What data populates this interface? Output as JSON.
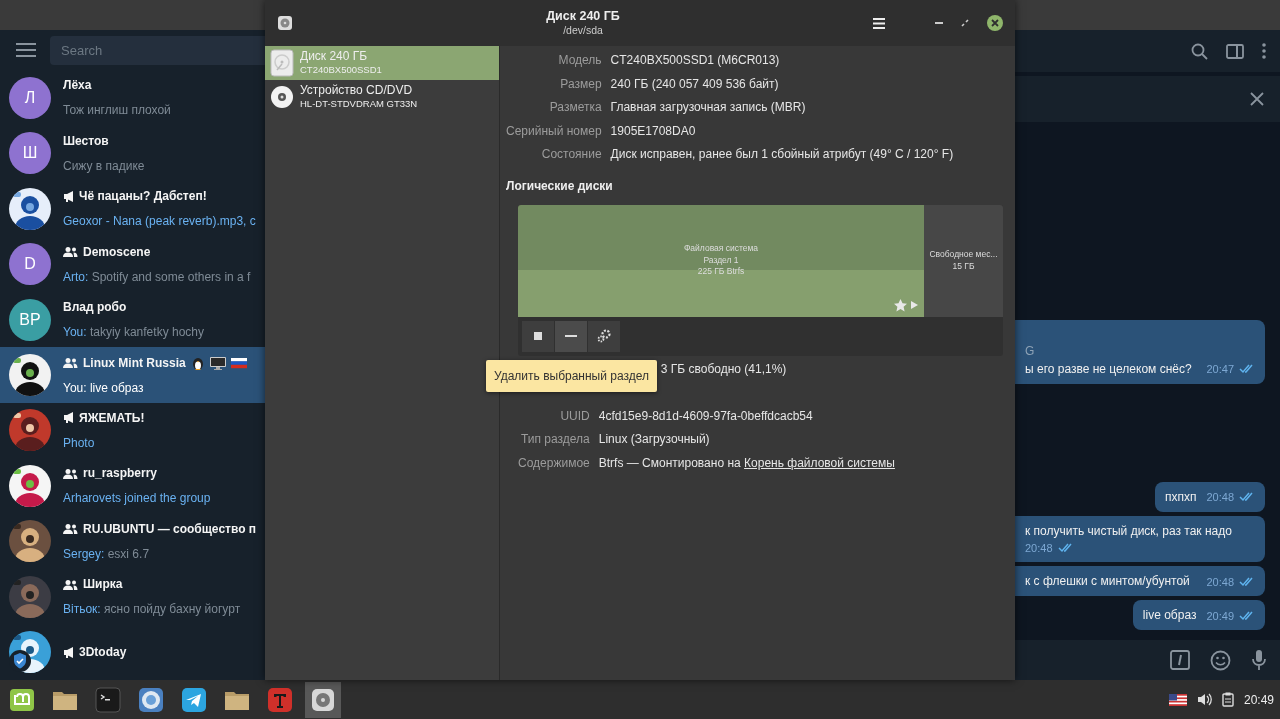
{
  "telegram": {
    "search": {
      "placeholder": "Search"
    },
    "chats": [
      {
        "name": "Лёха",
        "kind": "user",
        "avatar": {
          "kind": "letter",
          "letter": "Л",
          "color": "#8e72d0"
        },
        "preview": {
          "text": "Тож инглиш плохой",
          "highlight": false
        },
        "selected": false,
        "emoji_badges": false
      },
      {
        "name": "Шестов",
        "kind": "user",
        "avatar": {
          "kind": "letter",
          "letter": "Ш",
          "color": "#8e72d0"
        },
        "preview": {
          "text": "Сижу в падике",
          "highlight": false
        },
        "selected": false,
        "emoji_badges": false
      },
      {
        "name": "Чё пацаны? Дабстеп!",
        "kind": "channel",
        "preview": {
          "text": "Geoxor - Nana (peak reverb).mp3, c",
          "highlight": true
        },
        "selected": false,
        "emoji_badges": false
      },
      {
        "name": "Demoscene",
        "kind": "group",
        "avatar": {
          "kind": "letter",
          "letter": "D",
          "color": "#8e72d0"
        },
        "preview": {
          "sender": "Arto:",
          "text": "Spotify and some others in a f",
          "highlight": false
        },
        "selected": false,
        "emoji_badges": false
      },
      {
        "name": "Влад робо",
        "kind": "user",
        "avatar": {
          "kind": "letter",
          "letter": "ВР",
          "color": "#3a9ea3"
        },
        "preview": {
          "sender": "You:",
          "text": "takyiy kanfetky hochy",
          "highlight": false
        },
        "selected": false,
        "emoji_badges": false
      },
      {
        "name": "Linux Mint Russia",
        "kind": "group",
        "preview": {
          "sender": "You:",
          "text": "live образ",
          "highlight": false
        },
        "selected": true,
        "emoji_badges": true
      },
      {
        "name": "ЯЖЕМАТЬ!",
        "kind": "channel",
        "preview": {
          "text": "Photo",
          "highlight": true
        },
        "selected": false,
        "emoji_badges": false
      },
      {
        "name": "ru_raspberry",
        "kind": "group",
        "preview": {
          "text": "Arharovets joined the group",
          "highlight": true
        },
        "selected": false,
        "emoji_badges": false
      },
      {
        "name": "RU.UBUNTU — сообщество п",
        "kind": "group",
        "preview": {
          "sender": "Sergey:",
          "text": "esxi 6.7",
          "highlight": false
        },
        "selected": false,
        "emoji_badges": false
      },
      {
        "name": "Ширка",
        "kind": "group",
        "preview": {
          "sender": "Вітьок:",
          "text": "ясно пойду бахну йогурт",
          "highlight": false
        },
        "selected": false,
        "emoji_badges": false
      },
      {
        "name": "3Dtoday",
        "kind": "channel",
        "selected": false,
        "emoji_badges": false
      }
    ],
    "messages": [
      {
        "lines": [
          "G",
          "ы его разве не целеком снёс?"
        ],
        "time": "20:47",
        "read": true
      },
      {
        "lines": [
          "пхпхп"
        ],
        "time": "20:48",
        "read": true
      },
      {
        "lines": [
          "к получить чистый диск, раз так надо"
        ],
        "time": "20:48",
        "read": true
      },
      {
        "lines": [
          "к с флешки с минтом/убунтой"
        ],
        "time": "20:48",
        "read": true
      },
      {
        "lines": [
          "live образ"
        ],
        "time": "20:49",
        "read": true
      }
    ]
  },
  "disks": {
    "window": {
      "title": "Диск 240 ГБ",
      "subtitle": "/dev/sda"
    },
    "devices": [
      {
        "kind": "hdd",
        "name": "Диск 240 ГБ",
        "model": "CT240BX500SSD1",
        "selected": true
      },
      {
        "kind": "optical",
        "name": "Устройство CD/DVD",
        "model": "HL-DT-STDVDRAM GT33N",
        "selected": false
      }
    ],
    "properties": [
      {
        "label": "Модель",
        "value": "CT240BX500SSD1 (M6CR013)"
      },
      {
        "label": "Размер",
        "value": "240 ГБ (240 057 409 536 байт)"
      },
      {
        "label": "Разметка",
        "value": "Главная загрузочная запись (MBR)"
      },
      {
        "label": "Серийный номер",
        "value": "1905E1708DA0"
      },
      {
        "label": "Состояние",
        "value": "Диск исправен, ранее был 1 сбойный атрибут (49° C / 120° F)"
      }
    ],
    "volumes_heading": "Логические диски",
    "partitions": [
      {
        "kind": "filesystem",
        "lines": [
          "Файловая система",
          "Раздел 1",
          "225 ГБ Btrfs"
        ],
        "selected": true,
        "mounted": true
      },
      {
        "kind": "free",
        "lines": [
          "Свободное мес...",
          "15 ГБ"
        ],
        "selected": false,
        "mounted": false
      }
    ],
    "toolbar": [
      {
        "kind": "stop",
        "hovered": false
      },
      {
        "kind": "remove",
        "hovered": true
      },
      {
        "kind": "settings",
        "hovered": false
      }
    ],
    "tooltip": "Удалить выбранный раздел",
    "partition_properties": [
      {
        "value": "3 ГБ свободно (41,1%)"
      },
      {
        "label": "UUID",
        "value": "4cfd15e9-8d1d-4609-97fa-0beffdcacb54"
      },
      {
        "label": "Тип раздела",
        "value": "Linux (Загрузочный)"
      },
      {
        "label": "Содержимое",
        "value": "Btrfs — Смонтировано на ",
        "link": "Корень файловой системы"
      }
    ]
  },
  "taskbar": {
    "apps": [
      {
        "kind": "mint",
        "active": false
      },
      {
        "kind": "folder",
        "active": false
      },
      {
        "kind": "terminal",
        "active": false
      },
      {
        "kind": "browser",
        "active": false
      },
      {
        "kind": "telegram",
        "active": false
      },
      {
        "kind": "folder",
        "active": false
      },
      {
        "kind": "fonts",
        "active": false
      },
      {
        "kind": "disks",
        "active": true
      }
    ],
    "clock": "20:49"
  }
}
